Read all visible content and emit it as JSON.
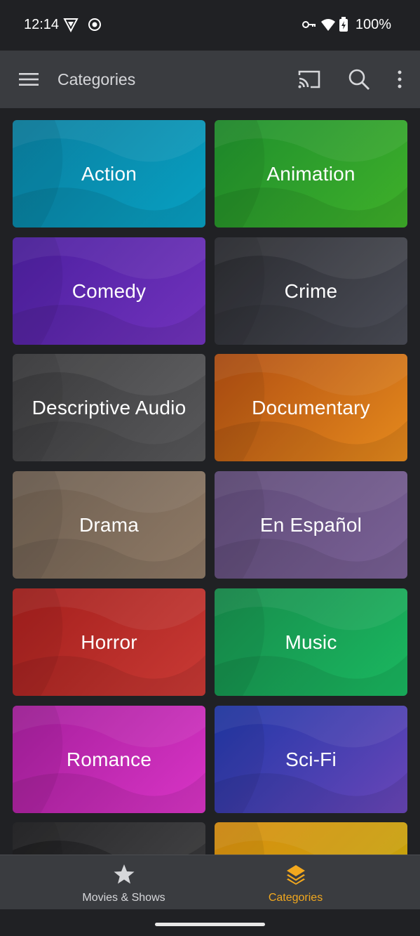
{
  "status_bar": {
    "time": "12:14",
    "battery": "100%",
    "icons": [
      "vpn-shield-icon",
      "record-icon",
      "key-icon",
      "wifi-icon",
      "battery-charging-icon"
    ]
  },
  "app_bar": {
    "title": "Categories",
    "icons": [
      "menu-icon",
      "cast-icon",
      "search-icon",
      "more-vert-icon"
    ]
  },
  "categories": [
    {
      "label": "Action",
      "color1": "#0a7fa0",
      "color2": "#08a0c2"
    },
    {
      "label": "Animation",
      "color1": "#1f8f2d",
      "color2": "#3fb02a"
    },
    {
      "label": "Comedy",
      "color1": "#4c1fa0",
      "color2": "#7233bd"
    },
    {
      "label": "Crime",
      "color1": "#2a2b30",
      "color2": "#4b4d57"
    },
    {
      "label": "Descriptive Audio",
      "color1": "#3a3a3c",
      "color2": "#59595b"
    },
    {
      "label": "Documentary",
      "color1": "#b14e12",
      "color2": "#e58a1d"
    },
    {
      "label": "Drama",
      "color1": "#6d5e50",
      "color2": "#8f7a66"
    },
    {
      "label": "En Español",
      "color1": "#5f4b78",
      "color2": "#7a6196"
    },
    {
      "label": "Horror",
      "color1": "#a41f1c",
      "color2": "#c93a35"
    },
    {
      "label": "Music",
      "color1": "#178c4c",
      "color2": "#1ab860"
    },
    {
      "label": "Romance",
      "color1": "#a51f9c",
      "color2": "#d934c6"
    },
    {
      "label": "Sci-Fi",
      "color1": "#2038a8",
      "color2": "#6a46b8"
    },
    {
      "label": "",
      "color1": "#1c1c1e",
      "color2": "#3c3c3e"
    },
    {
      "label": "",
      "color1": "#d98e10",
      "color2": "#c2a80c"
    }
  ],
  "bottom_nav": {
    "items": [
      {
        "label": "Movies & Shows",
        "icon": "star-icon",
        "active": false
      },
      {
        "label": "Categories",
        "icon": "layers-icon",
        "active": true
      }
    ],
    "active_color": "#f2a81e",
    "inactive_color": "#d6d7da"
  }
}
